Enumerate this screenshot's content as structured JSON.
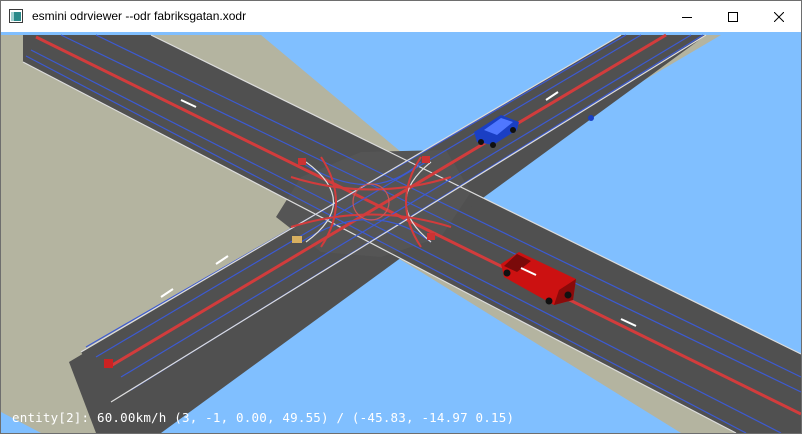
{
  "window": {
    "title": "esmini odrviewer --odr fabriksgatan.xodr",
    "icon": "app-icon",
    "controls": [
      "minimize-icon",
      "maximize-icon",
      "close-icon"
    ]
  },
  "scene": {
    "sky_color": "#80bfff",
    "asphalt_color": "#505050",
    "sidewalk_color": "#b4b4a0",
    "lane_line_red": "#d23c3c",
    "lane_line_blue": "#3c5ad2",
    "vehicles": [
      {
        "name": "blue-car",
        "color": "#1a3fc4"
      },
      {
        "name": "red-van",
        "color": "#cc1111"
      }
    ]
  },
  "status": {
    "text": "entity[2]: 60.00km/h (3, -1, 0.00, 49.55) / (-45.83, -14.97 0.15)"
  }
}
